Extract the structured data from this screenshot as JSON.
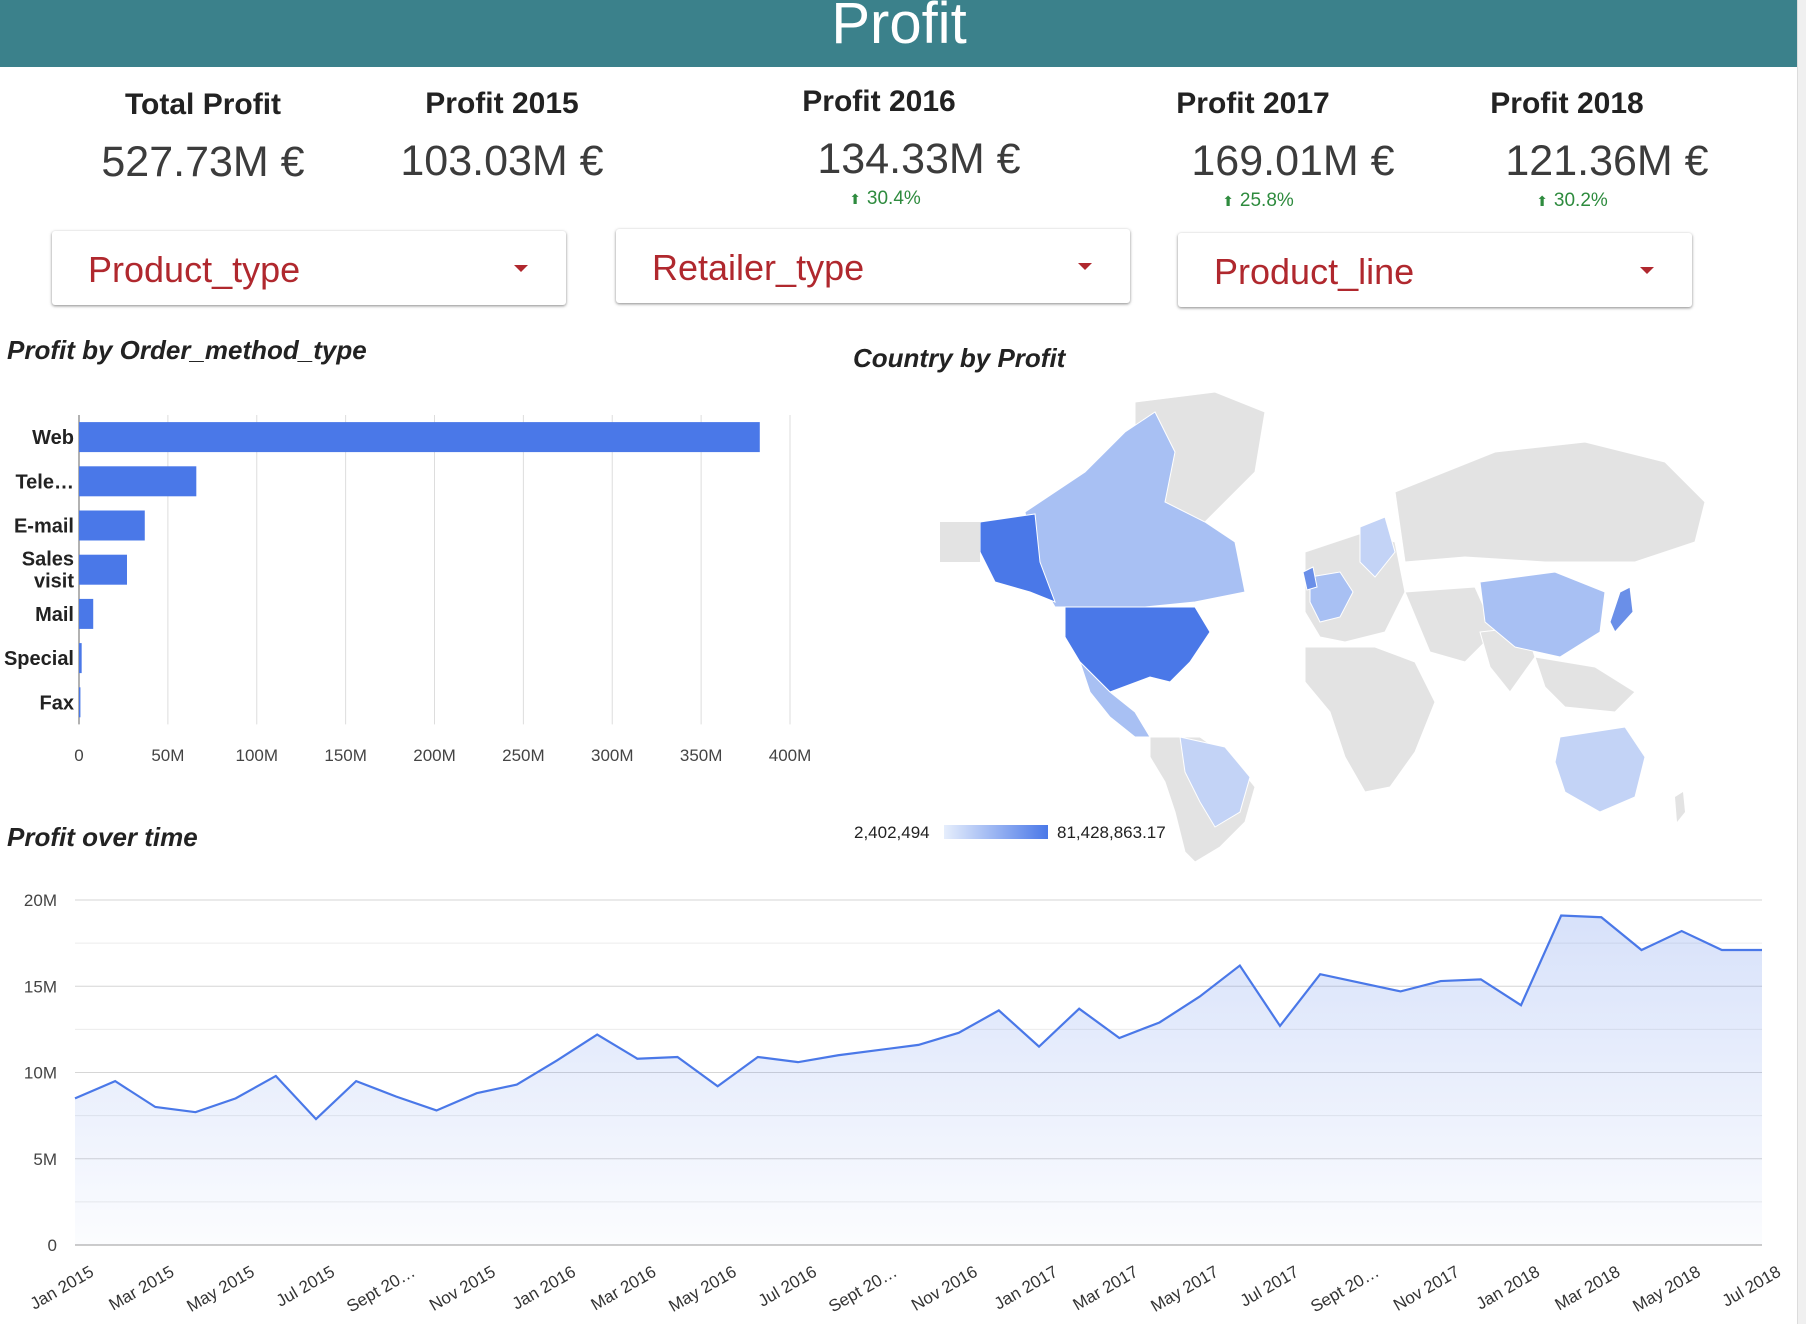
{
  "header": {
    "title": "Profit"
  },
  "kpis": {
    "total": {
      "label": "Total Profit",
      "value": "527.73M €"
    },
    "y2015": {
      "label": "Profit 2015",
      "value": "103.03M €"
    },
    "y2016": {
      "label": "Profit 2016",
      "value": "134.33M €",
      "delta": "30.4%"
    },
    "y2017": {
      "label": "Profit 2017",
      "value": "169.01M €",
      "delta": "25.8%"
    },
    "y2018": {
      "label": "Profit 2018",
      "value": "121.36M €",
      "delta": "30.2%"
    }
  },
  "filters": {
    "product_type": "Product_type",
    "retailer_type": "Retailer_type",
    "product_line": "Product_line"
  },
  "colors": {
    "header": "#3b818b",
    "accent": "#4a78e8",
    "filter_text": "#b0282e",
    "delta_up": "#2e8b3e"
  },
  "map": {
    "title": "Country by Profit",
    "legend_min": "2,402,494",
    "legend_max": "81,428,863.17"
  },
  "chart_data": [
    {
      "type": "bar",
      "orientation": "horizontal",
      "title": "Profit by Order_method_type",
      "categories": [
        "Web",
        "Tele…",
        "E-mail",
        "Sales visit",
        "Mail",
        "Special",
        "Fax"
      ],
      "values": [
        383000000,
        66000000,
        37000000,
        27000000,
        8000000,
        1500000,
        800000
      ],
      "xlim": [
        0,
        400000000
      ],
      "ticks": [
        "0",
        "50M",
        "100M",
        "150M",
        "200M",
        "250M",
        "300M",
        "350M",
        "400M"
      ],
      "grid": true
    },
    {
      "type": "area",
      "title": "Profit over time",
      "x": [
        "Jan 2015",
        "Feb 2015",
        "Mar 2015",
        "Apr 2015",
        "May 2015",
        "Jun 2015",
        "Jul 2015",
        "Aug 2015",
        "Sept 2015",
        "Oct 2015",
        "Nov 2015",
        "Dec 2015",
        "Jan 2016",
        "Feb 2016",
        "Mar 2016",
        "Apr 2016",
        "May 2016",
        "Jun 2016",
        "Jul 2016",
        "Aug 2016",
        "Sept 2016",
        "Oct 2016",
        "Nov 2016",
        "Dec 2016",
        "Jan 2017",
        "Feb 2017",
        "Mar 2017",
        "Apr 2017",
        "May 2017",
        "Jun 2017",
        "Jul 2017",
        "Aug 2017",
        "Sept 2017",
        "Oct 2017",
        "Nov 2017",
        "Dec 2017",
        "Jan 2018",
        "Feb 2018",
        "Mar 2018",
        "Apr 2018",
        "May 2018",
        "Jun 2018",
        "Jul 2018"
      ],
      "values": [
        8.5,
        9.5,
        8.0,
        7.7,
        8.5,
        9.8,
        7.3,
        9.5,
        8.6,
        7.8,
        8.8,
        9.3,
        10.7,
        12.2,
        10.8,
        10.9,
        9.2,
        10.9,
        10.6,
        11.0,
        11.3,
        11.6,
        12.3,
        13.6,
        11.5,
        13.7,
        12.0,
        12.9,
        14.4,
        16.2,
        12.7,
        15.7,
        15.2,
        14.7,
        15.3,
        15.4,
        13.9,
        19.1,
        19.0,
        17.1,
        18.2,
        17.1,
        17.1
      ],
      "value_unit": "M",
      "ylim": [
        0,
        20
      ],
      "y_ticks": [
        "0",
        "5M",
        "10M",
        "15M",
        "20M"
      ],
      "x_tick_labels": [
        "Jan 2015",
        "Mar 2015",
        "May 2015",
        "Jul 2015",
        "Sept 20…",
        "Nov 2015",
        "Jan 2016",
        "Mar 2016",
        "May 2016",
        "Jul 2016",
        "Sept 20…",
        "Nov 2016",
        "Jan 2017",
        "Mar 2017",
        "May 2017",
        "Jul 2017",
        "Sept 20…",
        "Nov 2017",
        "Jan 2018",
        "Mar 2018",
        "May 2018",
        "Jul 2018"
      ],
      "grid": true
    }
  ]
}
